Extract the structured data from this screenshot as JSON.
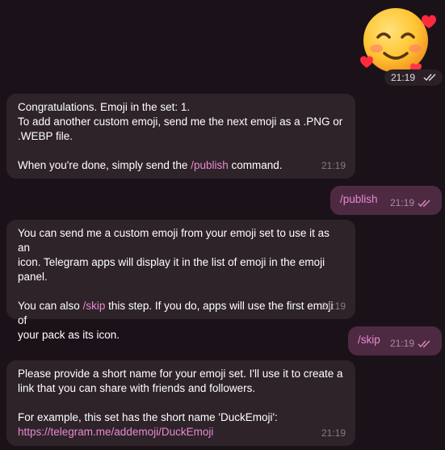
{
  "sticker": {
    "icon": "smiling-face-with-hearts-icon",
    "time": "21:19"
  },
  "messages": [
    {
      "lines": [
        "Congratulations. Emoji in the set: 1.",
        "To add another custom emoji, send me the next emoji as a .PNG or",
        ".WEBP file.",
        "",
        "When you're done, simply send the "
      ],
      "link": "/publish",
      "after": " command.",
      "time": "21:19"
    },
    {
      "text": "/publish",
      "time": "21:19"
    },
    {
      "lines": [
        "You can send me a custom emoji from your emoji set to use it as an",
        "icon. Telegram apps will display it in the list of emoji in the emoji",
        "panel.",
        "",
        "You can also "
      ],
      "link": "/skip",
      "after": " this step. If you do, apps will use the first emoji of",
      "after2": "your pack as its icon.",
      "time": "21:19"
    },
    {
      "text": "/skip",
      "time": "21:19"
    },
    {
      "lines": [
        "Please provide a short name for your emoji set. I'll use it to create a",
        "link that you can share with friends and followers.",
        "",
        "For example, this set has the short name 'DuckEmoji':"
      ],
      "link": "https://telegram.me/addemoji/DuckEmoji",
      "time": "21:19"
    }
  ],
  "colors": {
    "background": "#1b1219",
    "incoming": "#2e2329",
    "outgoing": "#4e2a42",
    "link": "#e78ad0"
  }
}
